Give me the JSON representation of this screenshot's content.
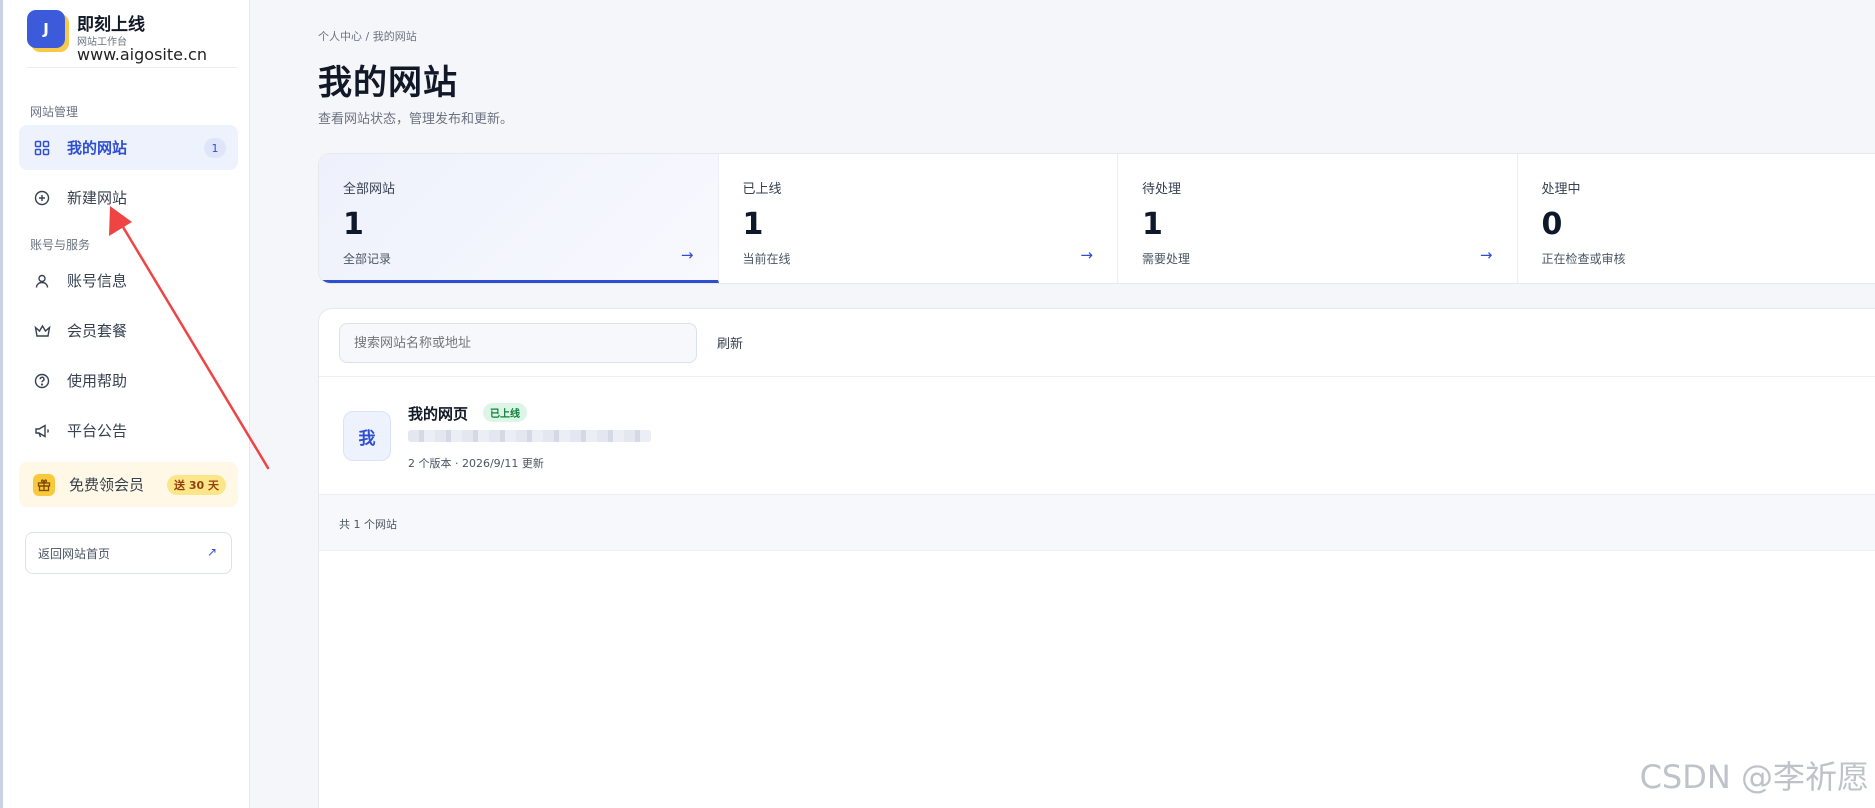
{
  "brand": {
    "logo_letter": "J",
    "name": "即刻上线",
    "subtitle": "网站工作台",
    "url": "www.aigosite.cn"
  },
  "sidebar": {
    "sections": [
      {
        "label": "网站管理"
      },
      {
        "label": "账号与服务"
      }
    ],
    "items": [
      {
        "label": "我的网站",
        "icon": "grid-icon",
        "count": "1",
        "active": true
      },
      {
        "label": "新建网站",
        "icon": "plus-circle-icon"
      },
      {
        "label": "账号信息",
        "icon": "user-icon"
      },
      {
        "label": "会员套餐",
        "icon": "crown-icon"
      },
      {
        "label": "使用帮助",
        "icon": "help-circle-icon"
      },
      {
        "label": "平台公告",
        "icon": "megaphone-icon"
      }
    ],
    "promo": {
      "label": "免费领会员",
      "badge": "送 30 天",
      "icon": "gift-icon"
    },
    "back_link": {
      "label": "返回网站首页",
      "icon": "external-link-icon",
      "icon_glyph": "↗"
    }
  },
  "breadcrumb": "个人中心 / 我的网站",
  "page": {
    "title": "我的网站",
    "description": "查看网站状态，管理发布和更新。"
  },
  "stats": [
    {
      "label": "全部网站",
      "value": "1",
      "sub": "全部记录",
      "arrow": "→",
      "active": true
    },
    {
      "label": "已上线",
      "value": "1",
      "sub": "当前在线",
      "arrow": "→"
    },
    {
      "label": "待处理",
      "value": "1",
      "sub": "需要处理",
      "arrow": "→"
    },
    {
      "label": "处理中",
      "value": "0",
      "sub": "正在检查或审核",
      "arrow": "→"
    }
  ],
  "search": {
    "placeholder": "搜索网站名称或地址"
  },
  "refresh_label": "刷新",
  "sites": [
    {
      "avatar": "我",
      "name": "我的网页",
      "status": "已上线",
      "meta": "2 个版本 · 2026/9/11 更新"
    }
  ],
  "total_label": "共 1 个网站",
  "watermark": "CSDN @李祈愿",
  "colors": {
    "accent": "#2f4fd1",
    "online_badge_bg": "#dcf5e6",
    "promo_bg": "#fff8e6",
    "annotation_arrow": "#ef4444"
  }
}
